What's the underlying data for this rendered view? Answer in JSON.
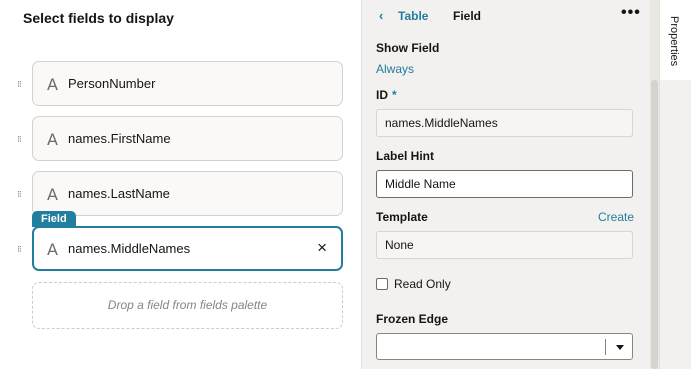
{
  "left_panel": {
    "title": "Select fields to display",
    "fields": [
      {
        "label": "PersonNumber"
      },
      {
        "label": "names.FirstName"
      },
      {
        "label": "names.LastName"
      },
      {
        "label": "names.MiddleNames",
        "selected": true
      }
    ],
    "field_icon": "A",
    "selected_tag": "Field",
    "remove_icon": "×",
    "dropzone": "Drop a field from fields palette"
  },
  "properties": {
    "breadcrumb": {
      "back_icon": "‹",
      "parent": "Table",
      "current": "Field"
    },
    "more_icon": "•••",
    "show_field": {
      "label": "Show Field",
      "value": "Always"
    },
    "id": {
      "label": "ID",
      "required": "*",
      "value": "names.MiddleNames"
    },
    "label_hint": {
      "label": "Label Hint",
      "value": "Middle Name"
    },
    "template": {
      "label": "Template",
      "create": "Create",
      "value": "None"
    },
    "read_only": {
      "label": "Read Only",
      "checked": false
    },
    "frozen_edge": {
      "label": "Frozen Edge",
      "value": ""
    }
  },
  "side_tab": {
    "label": "Properties"
  },
  "colors": {
    "accent": "#227e9e",
    "text": "#161513",
    "panel_bg": "#f3f1ef"
  }
}
